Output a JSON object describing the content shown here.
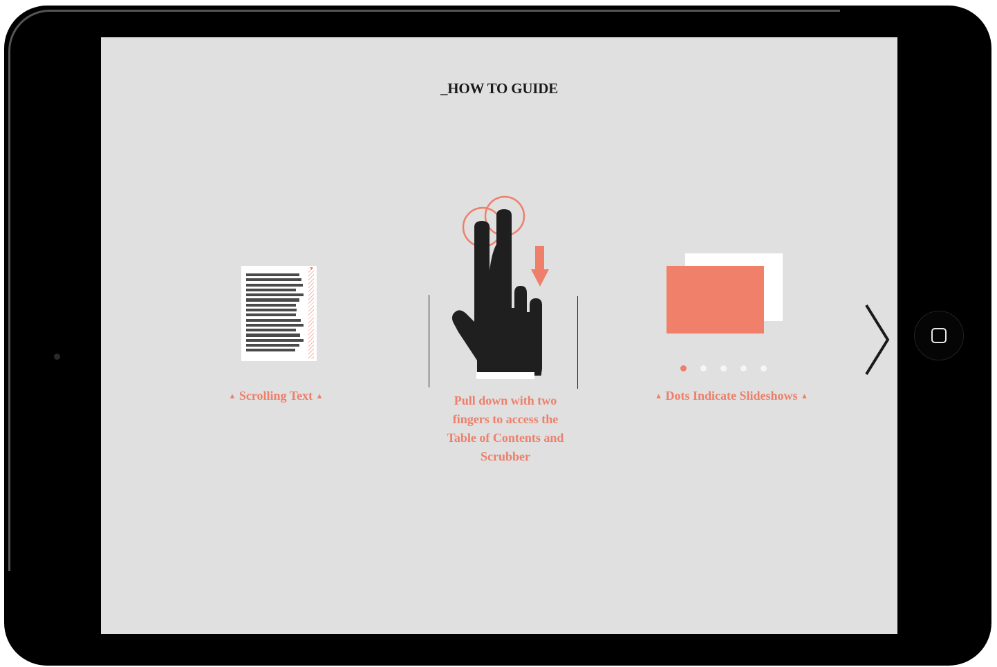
{
  "guide": {
    "title": "_HOW TO GUIDE"
  },
  "panels": {
    "scrolling": {
      "caption": "Scrolling Text",
      "triangle": "▲"
    },
    "gesture": {
      "caption": "Pull down with two fingers to access the Table of Contents and Scrubber"
    },
    "slideshow": {
      "caption": "Dots Indicate Slideshows",
      "triangle": "▲",
      "dot_count": 5,
      "active_dot": 1
    }
  },
  "navigation": {
    "next_icon": "chevron-right-icon"
  },
  "colors": {
    "accent": "#ef7f6a",
    "screen_bg": "#dfe0df",
    "ink": "#1f1f1f",
    "bezel": "#000000"
  }
}
